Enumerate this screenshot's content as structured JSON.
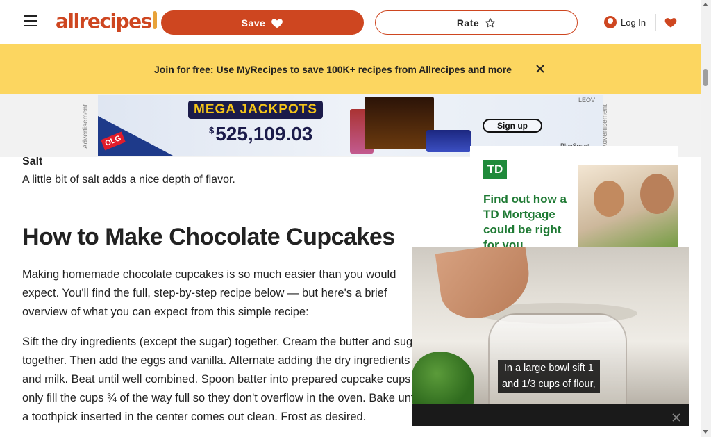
{
  "header": {
    "logo_text": "allrecipes",
    "save_label": "Save",
    "rate_label": "Rate",
    "login_label": "Log In"
  },
  "promo": {
    "link_text": "Join for free: Use MyRecipes to save 100K+ recipes from Allrecipes and more"
  },
  "ad_strip": {
    "label": "Advertisement",
    "brand": "OLG",
    "title": "MEGA JACKPOTS",
    "amount_prefix": "$",
    "amount": "525,109.03",
    "signup_label": "Sign up",
    "playsmart": "PlaySmart",
    "ad_choices": "LEOV"
  },
  "article": {
    "salt_fragment": "Salt",
    "salt_description": "A little bit of salt adds a nice depth of flavor.",
    "heading": "How to Make Chocolate Cupcakes",
    "intro": "Making homemade chocolate cupcakes is so much easier than you would expect. You'll find the full, step-by-step recipe below — but here's a brief overview of what you can expect from this simple recipe:",
    "steps_lines": [
      "Sift the dry ingredients (except the sugar) together. Cream the butter and sugar",
      "together. Then add the eggs and vanilla. Alternate adding the dry ingredients",
      "and milk. Beat until well combined. Spoon batter into prepared cupcake cups,",
      "only fill the cups ¾ of the way full so they don't overflow in the oven. Bake until",
      "a toothpick inserted in the center comes out clean. Frost as desired."
    ]
  },
  "td_ad": {
    "logo": "TD",
    "headline": "Find out how a TD Mortgage could be right for you"
  },
  "video": {
    "caption_line1": "In a large bowl sift 1",
    "caption_line2": "and 1/3 cups of flour,"
  },
  "colors": {
    "brand": "#ce4620",
    "promo_bg": "#fcd660",
    "td_green": "#1f8a3a"
  },
  "icons": [
    "hamburger-icon",
    "heart-icon",
    "star-icon",
    "user-icon",
    "saved-hearts-icon",
    "close-icon",
    "play-icon"
  ]
}
